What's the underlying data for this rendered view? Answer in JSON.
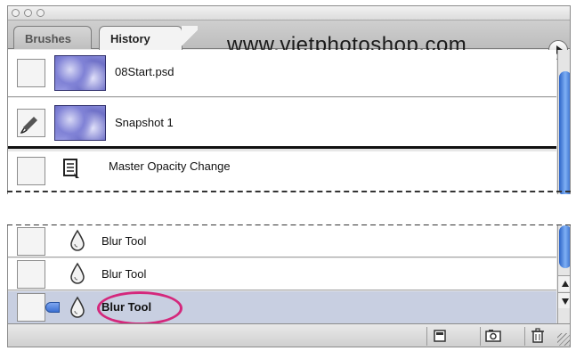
{
  "watermark": "www.vietphotoshop.com",
  "tabs": [
    {
      "label": "Brushes"
    },
    {
      "label": "History"
    }
  ],
  "history_top": [
    {
      "label": "08Start.psd",
      "type": "snapshot"
    },
    {
      "label": "Snapshot 1",
      "type": "snapshot"
    },
    {
      "label": "Master Opacity Change",
      "type": "state"
    }
  ],
  "history_bottom": [
    {
      "label": "Blur Tool",
      "type": "state"
    },
    {
      "label": "Blur Tool",
      "type": "state"
    },
    {
      "label": "Blur Tool",
      "type": "state",
      "selected": true
    }
  ],
  "footer": {
    "buttons": [
      "new-document-from-state-icon",
      "new-snapshot-icon",
      "trash-icon"
    ]
  },
  "colors": {
    "selection": "#c8cfe1",
    "highlight_oval": "#d4287c",
    "scroll_thumb": "#2b63c7"
  }
}
